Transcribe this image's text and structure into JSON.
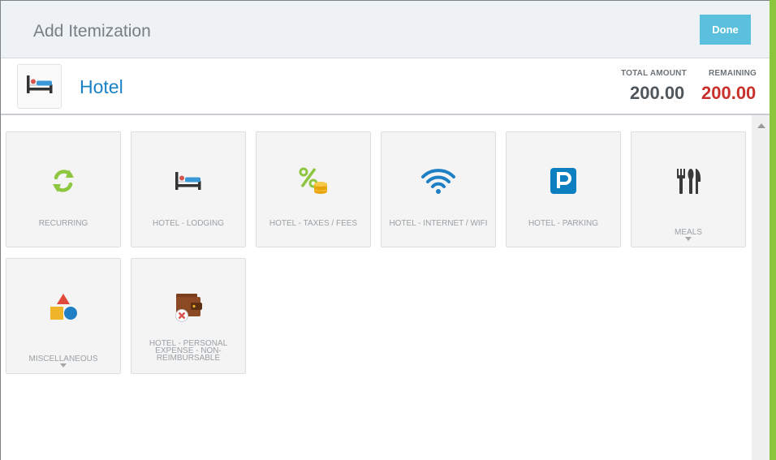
{
  "header": {
    "title": "Add Itemization",
    "done_label": "Done"
  },
  "expense": {
    "name": "Hotel",
    "icon": "hotel-bed-icon",
    "total_amount_label": "TOTAL AMOUNT",
    "total_amount": "200.00",
    "remaining_label": "REMAINING",
    "remaining": "200.00"
  },
  "colors": {
    "accent": "#5bc0de",
    "brand_blue": "#1a82c4",
    "remaining_red": "#c9302c",
    "side_bar": "#8cc63f"
  },
  "tiles": [
    {
      "label": "RECURRING",
      "icon": "recurring-icon",
      "has_submenu": false
    },
    {
      "label": "HOTEL - LODGING",
      "icon": "hotel-bed-icon",
      "has_submenu": false
    },
    {
      "label": "HOTEL - TAXES / FEES",
      "icon": "percent-coins-icon",
      "has_submenu": false
    },
    {
      "label": "HOTEL - INTERNET / WIFI",
      "icon": "wifi-icon",
      "has_submenu": false
    },
    {
      "label": "HOTEL - PARKING",
      "icon": "parking-icon",
      "has_submenu": false
    },
    {
      "label": "MEALS",
      "icon": "fork-knife-icon",
      "has_submenu": true
    },
    {
      "label": "MISCELLANEOUS",
      "icon": "shapes-icon",
      "has_submenu": true
    },
    {
      "label": "HOTEL - PERSONAL EXPENSE - NON-REIMBURSABLE",
      "icon": "wallet-x-icon",
      "has_submenu": false
    }
  ]
}
